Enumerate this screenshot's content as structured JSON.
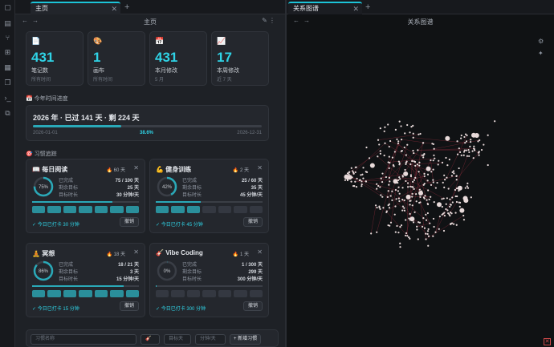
{
  "left_tab": {
    "title": "主页"
  },
  "right_tab": {
    "title": "关系图谱"
  },
  "left_nav": {
    "title": "主页"
  },
  "right_nav": {
    "title": "关系图谱"
  },
  "stats": [
    {
      "icon": "📄",
      "value": "431",
      "label": "笔记数",
      "sub": "所有时间"
    },
    {
      "icon": "🎨",
      "value": "1",
      "label": "画布",
      "sub": "所有时间"
    },
    {
      "icon": "📅",
      "value": "431",
      "label": "本月修改",
      "sub": "5 月"
    },
    {
      "icon": "📈",
      "value": "17",
      "label": "本周修改",
      "sub": "近 7 天"
    }
  ],
  "year_section": {
    "title": "📅 今年时间进度"
  },
  "year_progress": {
    "headline": "2026 年 · 已过 141 天 · 剩 224 天",
    "start": "2026-01-01",
    "end": "2026-12-31",
    "percent_label": "38.6%",
    "percent": 38.6
  },
  "habit_section": {
    "title": "🎯 习惯追踪"
  },
  "habits": [
    {
      "icon": "📖",
      "name": "每日阅读",
      "streak": "🔥 60 天",
      "ring": "75%",
      "ring_pct": 75,
      "rows": [
        {
          "k": "已完成",
          "v": "75 / 100 天"
        },
        {
          "k": "剩余目标",
          "v": "25 天"
        },
        {
          "k": "目标时长",
          "v": "30 分钟/天"
        }
      ],
      "days_on": 7,
      "done_text": "✓ 今日已打卡 30 分钟",
      "undo": "撤销"
    },
    {
      "icon": "💪",
      "name": "健身训练",
      "streak": "🔥 2 天",
      "ring": "42%",
      "ring_pct": 42,
      "rows": [
        {
          "k": "已完成",
          "v": "25 / 60 天"
        },
        {
          "k": "剩余目标",
          "v": "35 天"
        },
        {
          "k": "目标时长",
          "v": "45 分钟/天"
        }
      ],
      "days_on": 3,
      "done_text": "✓ 今日已打卡 45 分钟",
      "undo": "撤销"
    },
    {
      "icon": "🧘",
      "name": "冥想",
      "streak": "🔥 18 天",
      "ring": "86%",
      "ring_pct": 86,
      "rows": [
        {
          "k": "已完成",
          "v": "18 / 21 天"
        },
        {
          "k": "剩余目标",
          "v": "3 天"
        },
        {
          "k": "目标时长",
          "v": "15 分钟/天"
        }
      ],
      "days_on": 7,
      "done_text": "✓ 今日已打卡 15 分钟",
      "undo": "撤销"
    },
    {
      "icon": "🎸",
      "name": "Vibe Coding",
      "streak": "🔥 1 天",
      "ring": "0%",
      "ring_pct": 0.3,
      "rows": [
        {
          "k": "已完成",
          "v": "1 / 300 天"
        },
        {
          "k": "剩余目标",
          "v": "299 天"
        },
        {
          "k": "目标时长",
          "v": "300 分钟/天"
        }
      ],
      "days_on": 0,
      "done_text": "✓ 今日已打卡 300 分钟",
      "undo": "撤销"
    }
  ],
  "add_form": {
    "name_placeholder": "习惯名称",
    "emoji": "🎸",
    "target_days_placeholder": "目标天",
    "minutes_placeholder": "分钟/天",
    "add_label": "+ 新增习惯"
  },
  "colors": {
    "accent": "#2fd3e6",
    "progress": "#2aa9b8",
    "graph_node": "#e8dada",
    "graph_link": "#8a2a3a"
  }
}
